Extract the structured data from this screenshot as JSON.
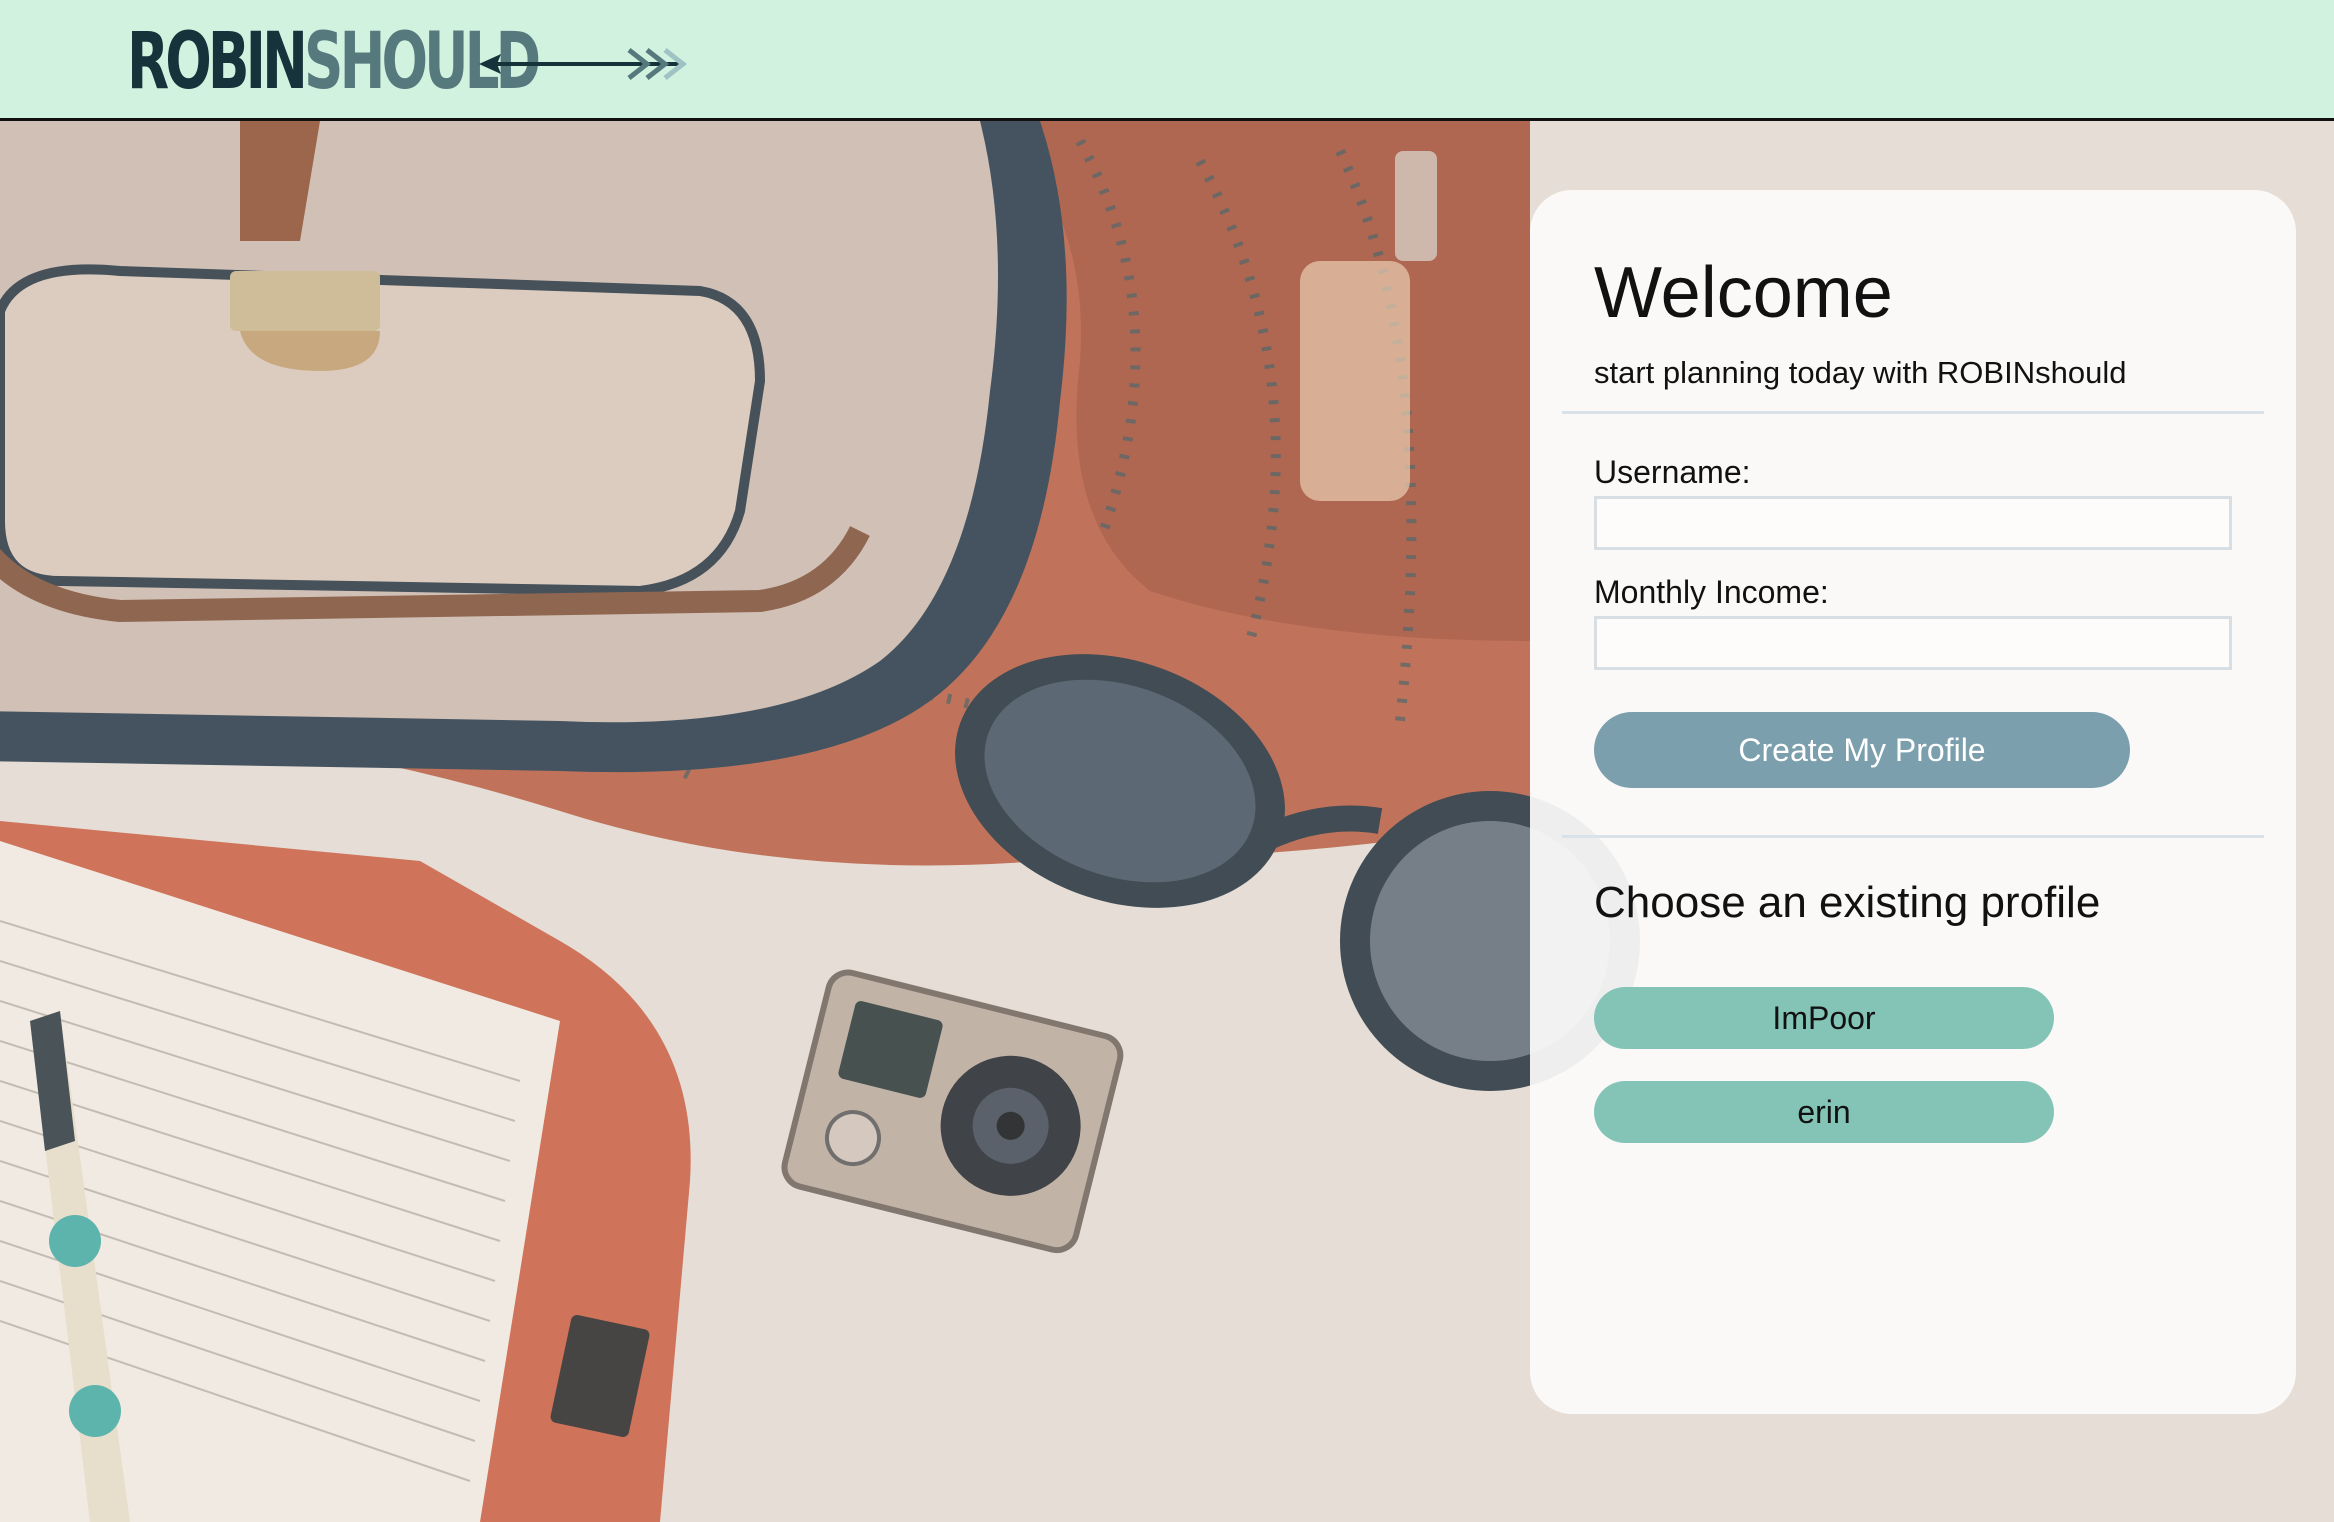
{
  "header": {
    "logo_part1": "ROBIN",
    "logo_part2": "SHOULD",
    "logo_arrow_icon": "arrow-icon",
    "colors": {
      "background": "#d2f2e0",
      "logo_dark": "#16323a",
      "logo_light": "#55797d"
    }
  },
  "panel": {
    "title": "Welcome",
    "subtitle": "start planning today with ROBINshould",
    "form": {
      "username_label": "Username:",
      "username_value": "",
      "income_label": "Monthly Income:",
      "income_value": "",
      "submit_label": "Create My Profile"
    },
    "existing": {
      "title": "Choose an existing profile",
      "profiles": [
        {
          "label": "ImPoor"
        },
        {
          "label": "erin"
        }
      ]
    },
    "colors": {
      "create_button": "#7b9fac",
      "profile_button": "#84c4b6"
    }
  }
}
